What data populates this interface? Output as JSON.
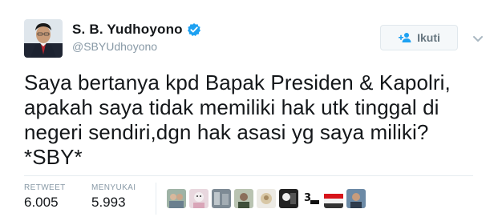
{
  "user": {
    "display_name": "S. B. Yudhoyono",
    "handle": "@SBYUdhoyono",
    "verified": true,
    "avatar_icon": "profile-photo"
  },
  "follow_button": {
    "label": "Ikuti",
    "icon": "add-user-icon"
  },
  "menu": {
    "icon": "chevron-down-icon"
  },
  "tweet": {
    "lines": [
      "Saya bertanya kpd Bapak Presiden & Kapolri,",
      "apakah saya tidak memiliki hak utk tinggal di",
      "negeri sendiri,dgn hak asasi yg saya miliki?",
      "*SBY*"
    ]
  },
  "stats": {
    "retweet_label": "RETWEET",
    "retweet_count": "6.005",
    "like_label": "MENYUKAI",
    "like_count": "5.993"
  },
  "likers": [
    {
      "name": "liker-avatar-1"
    },
    {
      "name": "liker-avatar-2"
    },
    {
      "name": "liker-avatar-3"
    },
    {
      "name": "liker-avatar-4"
    },
    {
      "name": "liker-avatar-5"
    },
    {
      "name": "liker-avatar-6"
    },
    {
      "name": "liker-avatar-7"
    },
    {
      "name": "liker-avatar-8"
    },
    {
      "name": "liker-avatar-9"
    }
  ],
  "colors": {
    "verified_blue": "#1da1f2",
    "muted_text": "#8899a6",
    "border": "#e1e8ed"
  }
}
